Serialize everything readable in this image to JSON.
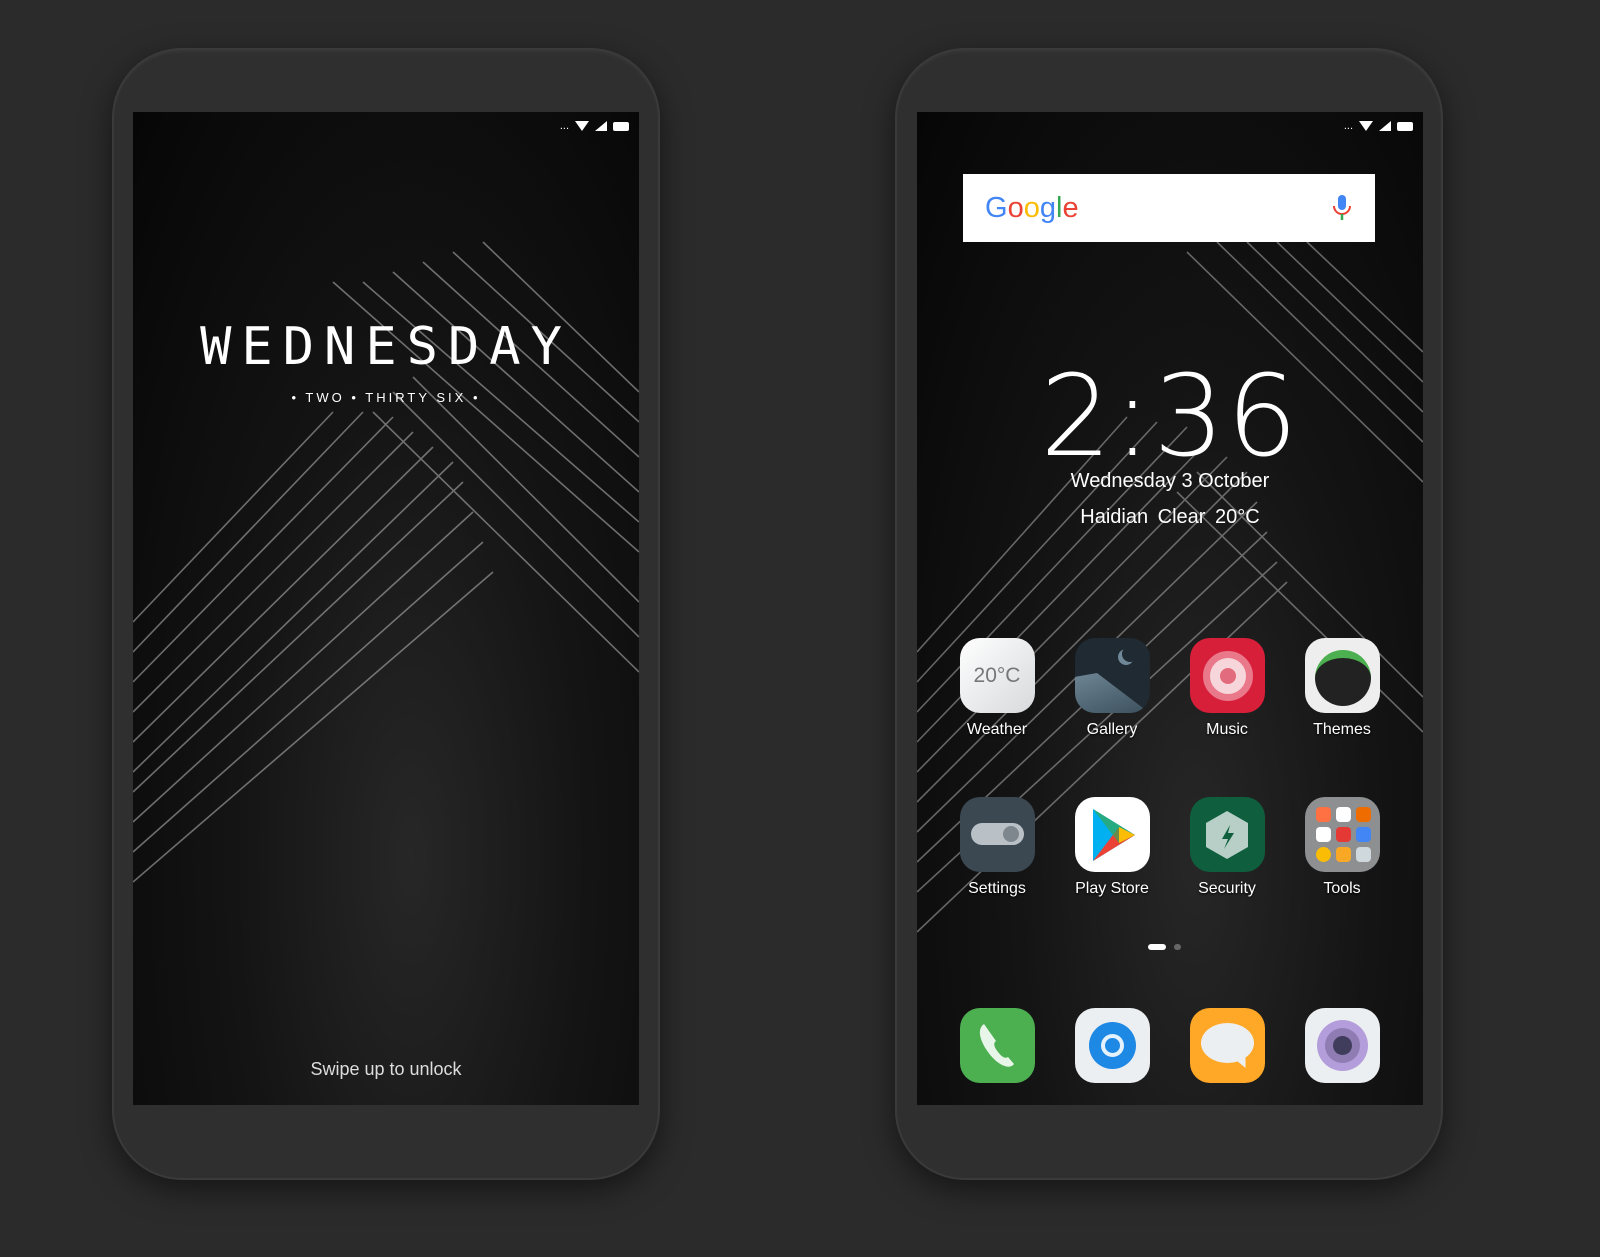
{
  "lock_screen": {
    "status": "...",
    "day": "WEDNESDAY",
    "time_words": "• TWO • THIRTY SIX •",
    "unlock_hint": "Swipe up to unlock"
  },
  "home_screen": {
    "status": "...",
    "search": {
      "logo": "Google",
      "mic_icon": "mic-icon"
    },
    "clock": {
      "time": "2:36",
      "date": "Wednesday 3 October",
      "weather": "Haidian  Clear  20°C"
    },
    "weather_icon_text": "20°C",
    "apps": [
      {
        "label": "Weather",
        "icon": "weather-icon"
      },
      {
        "label": "Gallery",
        "icon": "gallery-icon"
      },
      {
        "label": "Music",
        "icon": "music-icon"
      },
      {
        "label": "Themes",
        "icon": "themes-icon"
      },
      {
        "label": "Settings",
        "icon": "settings-icon"
      },
      {
        "label": "Play Store",
        "icon": "play-store-icon"
      },
      {
        "label": "Security",
        "icon": "security-icon"
      },
      {
        "label": "Tools",
        "icon": "tools-folder-icon"
      }
    ],
    "dock": [
      {
        "icon": "phone-icon"
      },
      {
        "icon": "browser-icon"
      },
      {
        "icon": "messages-icon"
      },
      {
        "icon": "camera-icon"
      }
    ],
    "page_indicator": {
      "pages": 2,
      "current": 1
    }
  },
  "colors": {
    "background": "#2b2b2b",
    "music": "#d81f3a",
    "security": "#0f5e3e",
    "phone": "#4caf50",
    "messages": "#ffa726"
  }
}
